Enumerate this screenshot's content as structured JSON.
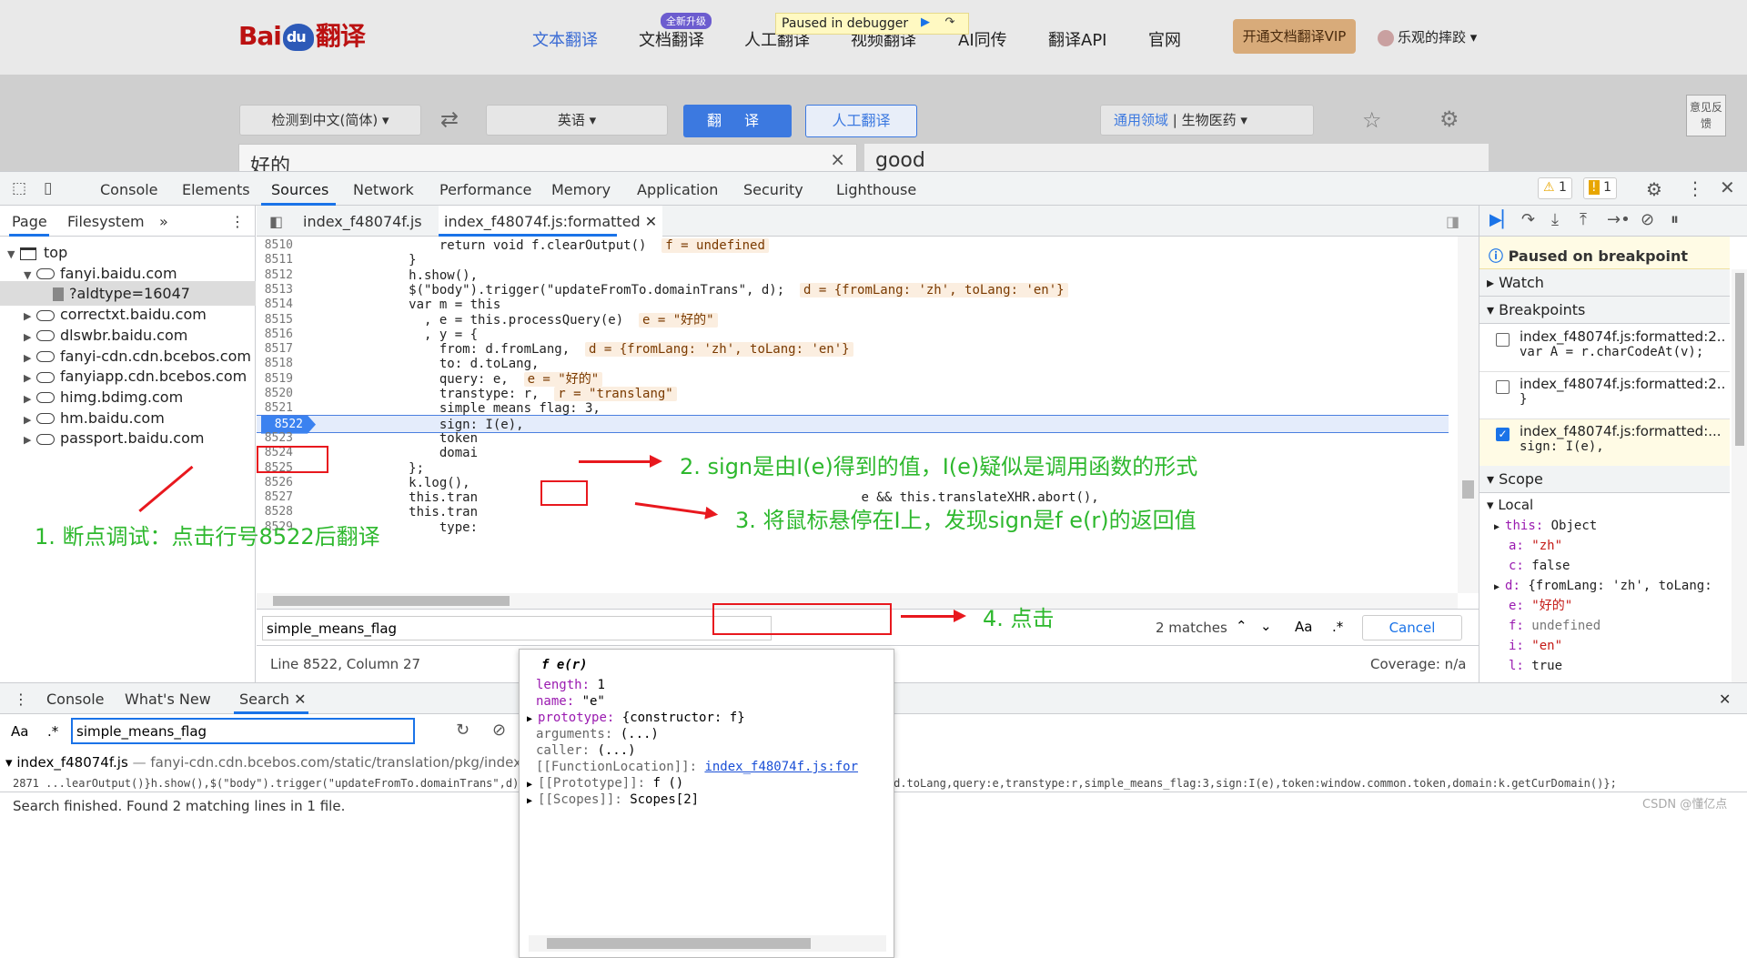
{
  "site": {
    "logo_text": "Bai",
    "logo_paw": "du",
    "logo_suffix": "翻译",
    "nav": [
      "文本翻译",
      "文档翻译",
      "人工翻译",
      "视频翻译",
      "AI同传",
      "翻译API",
      "官网"
    ],
    "nav_badge": "全新升级",
    "debugger_banner": "Paused in debugger",
    "vip_button": "开通文档翻译VIP",
    "user_name": "乐观的摔跤",
    "source_lang": "检测到中文(简体)",
    "target_lang": "英语",
    "translate_button": "翻 译",
    "human_button": "人工翻译",
    "domain_label": "通用领域",
    "domain_value": "生物医药",
    "feedback": "意见反馈",
    "source_text": "好的",
    "target_text": "good"
  },
  "devtools": {
    "tabs": [
      "Console",
      "Elements",
      "Sources",
      "Network",
      "Performance",
      "Memory",
      "Application",
      "Security",
      "Lighthouse"
    ],
    "active_tab": "Sources",
    "warnings": "1",
    "issues": "1",
    "nav_subtabs": [
      "Page",
      "Filesystem"
    ],
    "tree": [
      {
        "label": "top",
        "kind": "window",
        "depth": 0,
        "open": true
      },
      {
        "label": "fanyi.baidu.com",
        "kind": "cloud",
        "depth": 1,
        "open": true
      },
      {
        "label": "?aldtype=16047",
        "kind": "file",
        "depth": 2,
        "selected": true
      },
      {
        "label": "correctxt.baidu.com",
        "kind": "cloud",
        "depth": 1
      },
      {
        "label": "dlswbr.baidu.com",
        "kind": "cloud",
        "depth": 1
      },
      {
        "label": "fanyi-cdn.cdn.bcebos.com",
        "kind": "cloud",
        "depth": 1
      },
      {
        "label": "fanyiapp.cdn.bcebos.com",
        "kind": "cloud",
        "depth": 1
      },
      {
        "label": "himg.bdimg.com",
        "kind": "cloud",
        "depth": 1
      },
      {
        "label": "hm.baidu.com",
        "kind": "cloud",
        "depth": 1
      },
      {
        "label": "passport.baidu.com",
        "kind": "cloud",
        "depth": 1
      }
    ],
    "editor_tabs": [
      "index_f48074f.js",
      "index_f48074f.js:formatted"
    ],
    "code": [
      {
        "ln": "8510",
        "text": "                return void f.clearOutput()",
        "val": "f = undefined"
      },
      {
        "ln": "8511",
        "text": "            }"
      },
      {
        "ln": "8512",
        "text": "            h.show(),"
      },
      {
        "ln": "8513",
        "text": "            $(\"body\").trigger(\"updateFromTo.domainTrans\", d);",
        "val": "d = {fromLang: 'zh', toLang: 'en'}"
      },
      {
        "ln": "8514",
        "text": "            var m = this"
      },
      {
        "ln": "8515",
        "text": "              , e = this.processQuery(e)",
        "val": "e = \"好的\""
      },
      {
        "ln": "8516",
        "text": "              , y = {"
      },
      {
        "ln": "8517",
        "text": "                from: d.fromLang,",
        "val": "d = {fromLang: 'zh', toLang: 'en'}"
      },
      {
        "ln": "8518",
        "text": "                to: d.toLang,"
      },
      {
        "ln": "8519",
        "text": "                query: e,",
        "val": "e = \"好的\""
      },
      {
        "ln": "8520",
        "text": "                transtype: r,",
        "val": "r = \"translang\""
      },
      {
        "ln": "8521",
        "text": "                simple_means_flag: 3,"
      },
      {
        "ln": "8522",
        "text": "                sign: I(e),"
      },
      {
        "ln": "8523",
        "text": "                token"
      },
      {
        "ln": "8524",
        "text": "                domai"
      },
      {
        "ln": "8525",
        "text": "            };"
      },
      {
        "ln": "8526",
        "text": "            k.log(),"
      },
      {
        "ln": "8527",
        "text": "            this.tran                                                  e && this.translateXHR.abort(),"
      },
      {
        "ln": "8528",
        "text": "            this.tran"
      },
      {
        "ln": "8529",
        "text": "                type:"
      }
    ],
    "search_query": "simple_means_flag",
    "search_matches": "2 matches",
    "search_cancel": "Cancel",
    "status_position": "Line 8522, Column 27",
    "status_coverage": "Coverage: n/a",
    "paused_on": "Paused on breakpoint",
    "sections": {
      "watch": "Watch",
      "breakpoints": "Breakpoints",
      "scope": "Scope",
      "local": "Local"
    },
    "breakpoints": [
      {
        "file": "index_f48074f.js:formatted:2...",
        "code": "var A = r.charCodeAt(v);",
        "checked": false
      },
      {
        "file": "index_f48074f.js:formatted:2...",
        "code": "}",
        "checked": false
      },
      {
        "file": "index_f48074f.js:formatted:...",
        "code": "sign: I(e),",
        "checked": true
      }
    ],
    "scope": [
      {
        "k": "this",
        "v": "Object",
        "expand": true
      },
      {
        "k": "a",
        "v": "\"zh\"",
        "t": "str"
      },
      {
        "k": "c",
        "v": "false"
      },
      {
        "k": "d",
        "v": "{fromLang: 'zh', toLang:",
        "expand": true
      },
      {
        "k": "e",
        "v": "\"好的\"",
        "t": "str"
      },
      {
        "k": "f",
        "v": "undefined",
        "t": "grey"
      },
      {
        "k": "i",
        "v": "\"en\"",
        "t": "str"
      },
      {
        "k": "l",
        "v": "true"
      }
    ],
    "popover": {
      "title": "f e(r)",
      "rows": [
        {
          "k": "length",
          "v": "1"
        },
        {
          "k": "name",
          "v": "\"e\""
        },
        {
          "k": "prototype",
          "v": "{constructor: f}",
          "expand": true
        },
        {
          "k": "arguments",
          "v": "(...)",
          "grey": true
        },
        {
          "k": "caller",
          "v": "(...)",
          "grey": true
        },
        {
          "k": "[[FunctionLocation]]",
          "v": "index_f48074f.js:for",
          "link": true,
          "grey": true
        },
        {
          "k": "[[Prototype]]",
          "v": "f ()",
          "expand": true,
          "grey": true
        },
        {
          "k": "[[Scopes]]",
          "v": "Scopes[2]",
          "expand": true,
          "grey": true
        }
      ]
    },
    "drawer_tabs": [
      "Console",
      "What's New",
      "Search"
    ],
    "drawer_search": "simple_means_flag",
    "result_file": "index_f48074f.js",
    "result_url": "fanyi-cdn.cdn.bcebos.com/static/translation/pkg/index_f",
    "result_line": "2871 ...learOutput()}h.show(),$(\"body\").trigger(\"updateFromTo.domainTrans\",d);var m=this,e=this.processQuery(e),y={from:d.fromLang,to:d.toLang,query:e,transtype:r,simple_means_flag:3,sign:I(e),token:window.common.token,domain:k.getCurDomain()};",
    "search_status": "Search finished.  Found 2 matching lines in 1 file."
  },
  "annotations": {
    "a1": "1. 断点调试：点击行号8522后翻译",
    "a2": "2. sign是由I(e)得到的值，I(e)疑似是调用函数的形式",
    "a3": "3. 将鼠标悬停在I上，发现sign是f e(r)的返回值",
    "a4": "4. 点击"
  },
  "watermark": "CSDN @懂亿点"
}
